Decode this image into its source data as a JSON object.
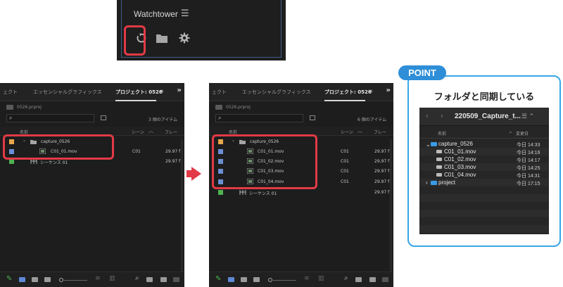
{
  "watchtower": {
    "title": "Watchtower",
    "menu_icon": "hamburger-icon",
    "icons": [
      "refresh-icon",
      "folder-icon",
      "gear-icon"
    ]
  },
  "panel_before": {
    "tabs": [
      "ェクト",
      "エッセンシャルグラフィックス",
      "プロジェクト: 0526"
    ],
    "overflow": "»",
    "project_file": "0526.prproj",
    "item_count": "3 個のアイテム",
    "columns": [
      "名前",
      "シーン",
      "フレー"
    ],
    "rows": [
      {
        "name": "capture_0526",
        "scene": "",
        "rate": "",
        "type": "bin",
        "color": "#e8a64a"
      },
      {
        "name": "C01_01.mov",
        "scene": "C01",
        "rate": "29.97 f",
        "type": "clip",
        "color": "#6b8fd6"
      },
      {
        "name": "シーケンス 01",
        "scene": "",
        "rate": "29.97 f",
        "type": "sequence",
        "color": "#4fb34f"
      }
    ]
  },
  "panel_after": {
    "tabs": [
      "ェクト",
      "エッセンシャルグラフィックス",
      "プロジェクト: 0526"
    ],
    "overflow": "»",
    "project_file": "0526.prproj",
    "item_count": "6 個のアイテム",
    "columns": [
      "名前",
      "シーン",
      "フレー"
    ],
    "rows": [
      {
        "name": "capture_0526",
        "scene": "",
        "rate": "",
        "type": "bin",
        "color": "#e8a64a"
      },
      {
        "name": "C01_01.mov",
        "scene": "C01",
        "rate": "29.97 f",
        "type": "clip",
        "color": "#6b8fd6"
      },
      {
        "name": "C01_02.mov",
        "scene": "C01",
        "rate": "29.97 f",
        "type": "clip",
        "color": "#6b8fd6"
      },
      {
        "name": "C01_03.mov",
        "scene": "C01",
        "rate": "29.97 f",
        "type": "clip",
        "color": "#6b8fd6"
      },
      {
        "name": "C01_04.mov",
        "scene": "C01",
        "rate": "29.97 f",
        "type": "clip",
        "color": "#6b8fd6"
      },
      {
        "name": "シーケンス 01",
        "scene": "",
        "rate": "29.97 f",
        "type": "sequence",
        "color": "#4fb34f"
      }
    ]
  },
  "point": {
    "badge": "POINT",
    "title": "フォルダと同期している"
  },
  "finder": {
    "folder_title": "220509_Capture_t...",
    "col_name": "名前",
    "col_date": "変更日",
    "rows": [
      {
        "name": "capture_0526",
        "date": "今日 14:33",
        "kind": "folder",
        "expanded": true
      },
      {
        "name": "C01_01.mov",
        "date": "今日 14:16",
        "kind": "file"
      },
      {
        "name": "C01_02.mov",
        "date": "今日 14:17",
        "kind": "file"
      },
      {
        "name": "C01_03.mov",
        "date": "今日 14:25",
        "kind": "file"
      },
      {
        "name": "C01_04.mov",
        "date": "今日 14:31",
        "kind": "file"
      },
      {
        "name": "project",
        "date": "今日 17:15",
        "kind": "folder",
        "expanded": false
      }
    ]
  },
  "colors": {
    "highlight": "#e23a46",
    "point_blue": "#2e8ed8",
    "folder_blue": "#3a9be6"
  }
}
